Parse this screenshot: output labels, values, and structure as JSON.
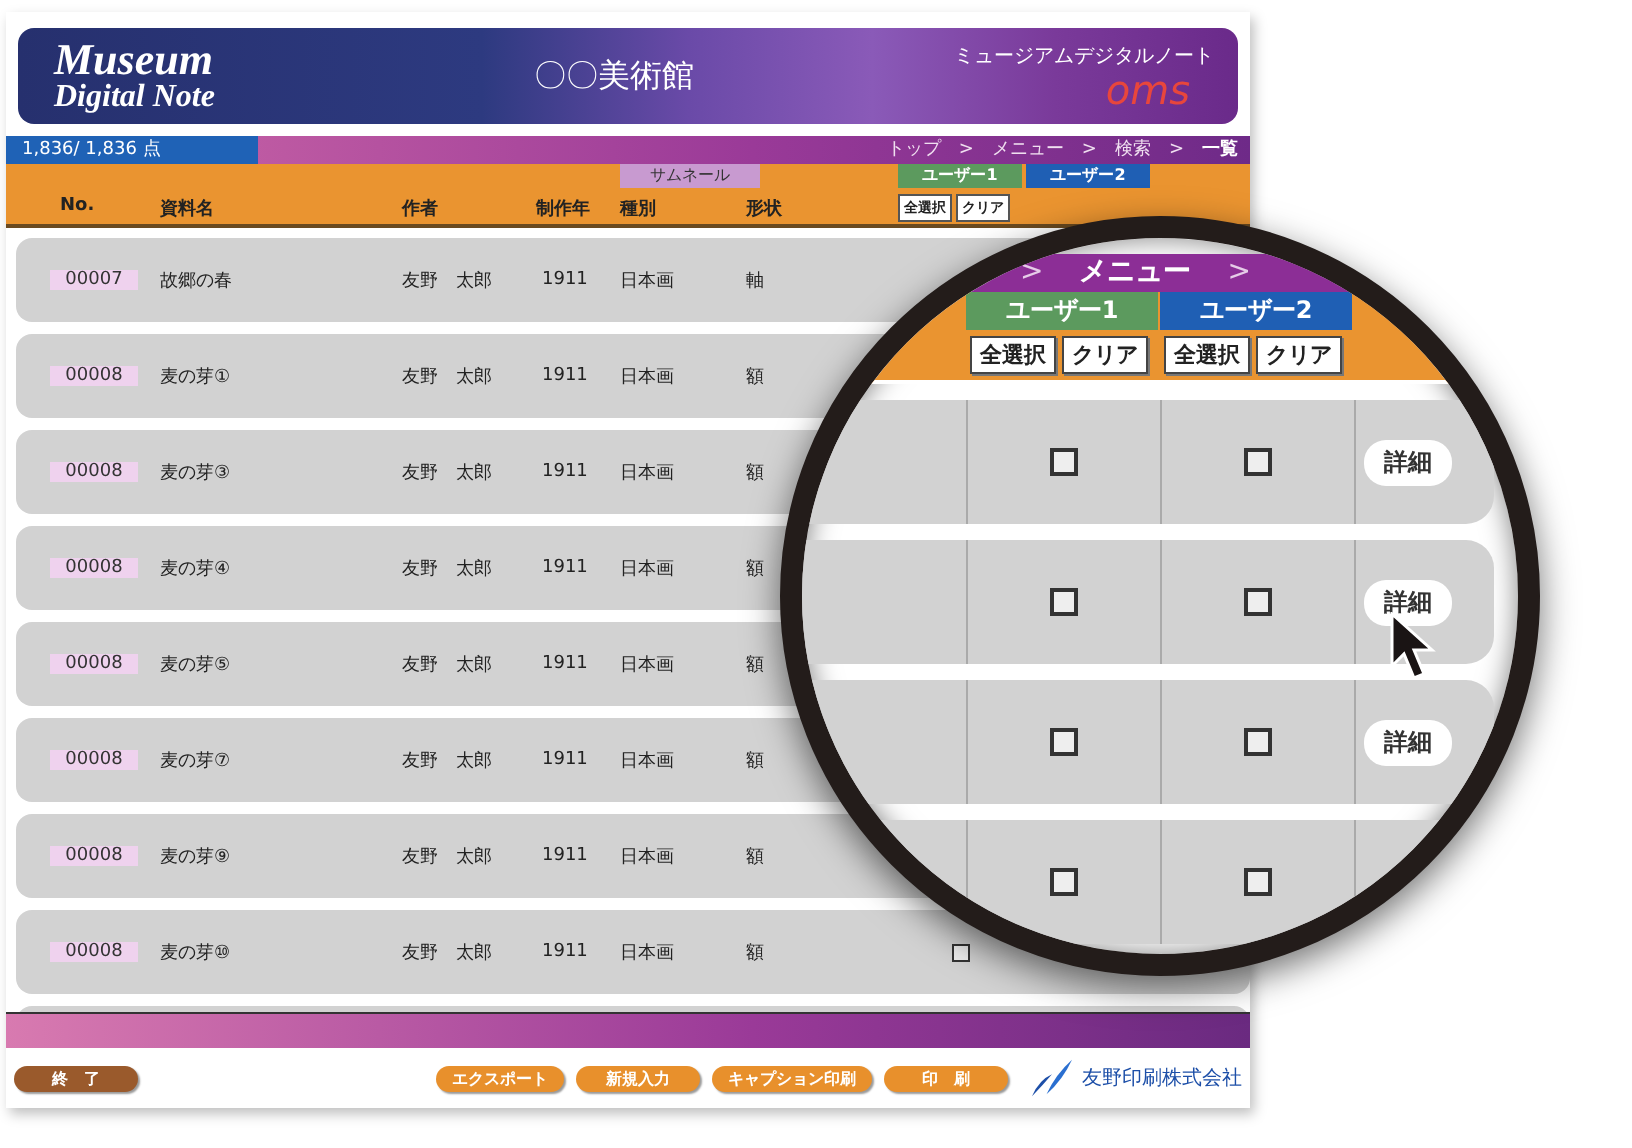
{
  "header": {
    "logo_line1": "Museum",
    "logo_line2": "Digital Note",
    "museum_name": "〇〇美術館",
    "product_name": "ミュージアムデジタルノート",
    "brand": "oms"
  },
  "count": "1,836/ 1,836 点",
  "breadcrumb": [
    {
      "kind": "link",
      "text": "トップ"
    },
    {
      "kind": "sep",
      "text": ">"
    },
    {
      "kind": "link",
      "text": "メニュー"
    },
    {
      "kind": "sep",
      "text": ">"
    },
    {
      "kind": "link",
      "text": "検索"
    },
    {
      "kind": "sep",
      "text": ">"
    },
    {
      "kind": "current",
      "text": "一覧"
    }
  ],
  "thumbnail_label": "サムネール",
  "columns": [
    "No.",
    "資料名",
    "作者",
    "制作年",
    "種別",
    "形状"
  ],
  "users": [
    {
      "label": "ユーザー1",
      "color": "#5c9a5e",
      "buttons": [
        "全選択",
        "クリア"
      ]
    },
    {
      "label": "ユーザー2",
      "color": "#1f5fb4"
    }
  ],
  "rows": [
    {
      "no": "00007",
      "title": "故郷の春",
      "author": "友野　太郎",
      "year": "1911",
      "type": "日本画",
      "shape": "軸"
    },
    {
      "no": "00008",
      "title": "麦の芽①",
      "author": "友野　太郎",
      "year": "1911",
      "type": "日本画",
      "shape": "額"
    },
    {
      "no": "00008",
      "title": "麦の芽③",
      "author": "友野　太郎",
      "year": "1911",
      "type": "日本画",
      "shape": "額"
    },
    {
      "no": "00008",
      "title": "麦の芽④",
      "author": "友野　太郎",
      "year": "1911",
      "type": "日本画",
      "shape": "額"
    },
    {
      "no": "00008",
      "title": "麦の芽⑤",
      "author": "友野　太郎",
      "year": "1911",
      "type": "日本画",
      "shape": "額"
    },
    {
      "no": "00008",
      "title": "麦の芽⑦",
      "author": "友野　太郎",
      "year": "1911",
      "type": "日本画",
      "shape": "額"
    },
    {
      "no": "00008",
      "title": "麦の芽⑨",
      "author": "友野　太郎",
      "year": "1911",
      "type": "日本画",
      "shape": "額"
    },
    {
      "no": "00008",
      "title": "麦の芽⑩",
      "author": "友野　太郎",
      "year": "1911",
      "type": "日本画",
      "shape": "額",
      "user1": {
        "checked": false
      }
    }
  ],
  "magnifier": {
    "breadcrumb": [
      {
        "kind": "sep",
        "text": ">"
      },
      {
        "kind": "link",
        "text": "メニュー"
      },
      {
        "kind": "sep",
        "text": ">"
      }
    ],
    "users": [
      {
        "label": "ユーザー1",
        "color": "#5c9a5e",
        "buttons": [
          "全選択",
          "クリア"
        ]
      },
      {
        "label": "ユーザー2",
        "color": "#1f5fb4",
        "buttons": [
          "全選択",
          "クリア"
        ]
      }
    ],
    "rows": [
      {
        "user1_checked": false,
        "user2_checked": false,
        "detail": "詳細"
      },
      {
        "user1_checked": false,
        "user2_checked": false,
        "detail": "詳細",
        "hovered": true
      },
      {
        "user1_checked": false,
        "user2_checked": false,
        "detail": "詳細"
      },
      {
        "user1_checked": false,
        "user2_checked": false
      }
    ]
  },
  "footer": {
    "quit": "終　了",
    "actions": [
      "エクスポート",
      "新規入力",
      "キャプション印刷",
      "印　刷"
    ],
    "company": "友野印刷株式会社"
  }
}
